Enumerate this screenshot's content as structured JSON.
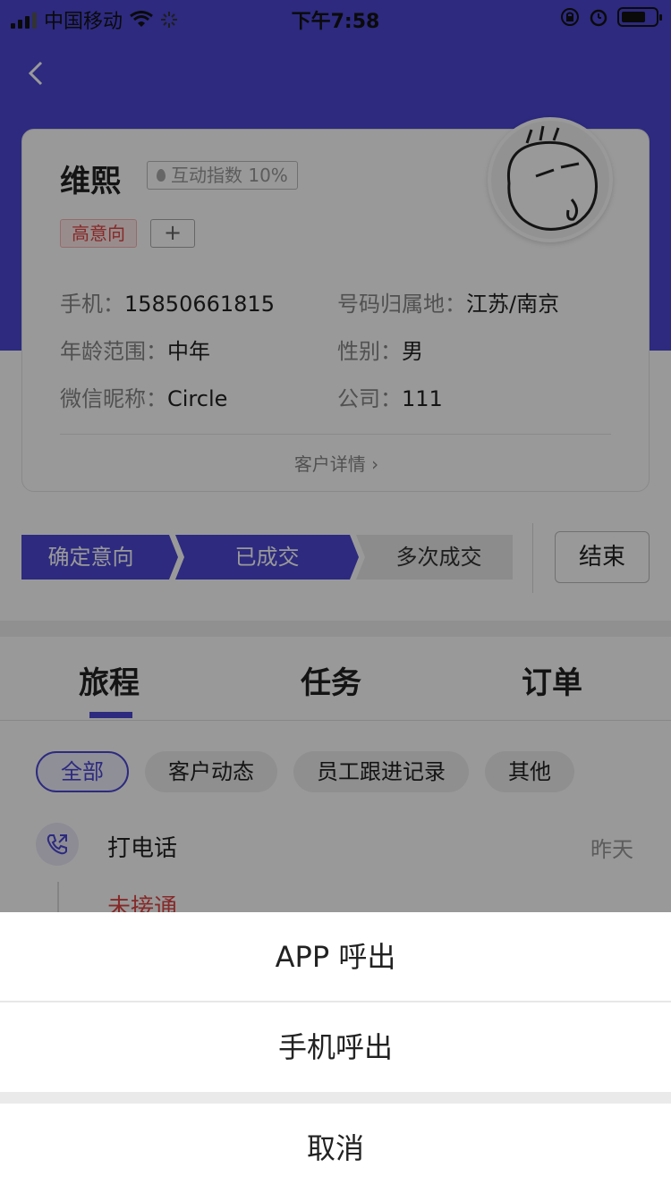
{
  "status_bar": {
    "carrier": "中国移动",
    "time": "下午7:58"
  },
  "customer": {
    "name": "维熙",
    "interaction_label": "互动指数 10%",
    "tag": "高意向",
    "add_tag": "+",
    "info": {
      "phone_label": "手机：",
      "phone": "15850661815",
      "location_label": "号码归属地：",
      "location": "江苏/南京",
      "age_label": "年龄范围：",
      "age": "中年",
      "gender_label": "性别：",
      "gender": "男",
      "wechat_label": "微信昵称：",
      "wechat": "Circle",
      "company_label": "公司：",
      "company": "111"
    },
    "detail_link": "客户详情 ›"
  },
  "stages": {
    "items": [
      "确定意向",
      "已成交",
      "多次成交"
    ],
    "end_label": "结束"
  },
  "tabs": [
    "旅程",
    "任务",
    "订单"
  ],
  "filters": [
    "全部",
    "客户动态",
    "员工跟进记录",
    "其他"
  ],
  "timeline": {
    "event_title": "打电话",
    "event_time": "昨天",
    "event_status": "未接通"
  },
  "action_sheet": {
    "app_call": "APP 呼出",
    "phone_call": "手机呼出",
    "cancel": "取消"
  },
  "colors": {
    "primary": "#4b46d4",
    "danger": "#e04545"
  }
}
